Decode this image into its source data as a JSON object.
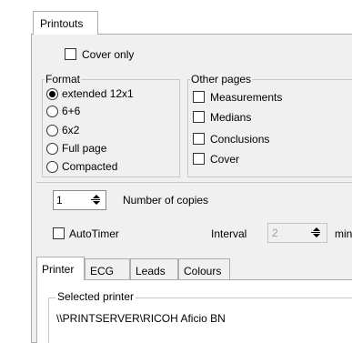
{
  "tabs": {
    "printouts": "Printouts"
  },
  "cover_only": {
    "label": "Cover only",
    "checked": false
  },
  "format": {
    "title": "Format",
    "options": [
      {
        "label": "extended 12x1",
        "selected": true
      },
      {
        "label": "6+6",
        "selected": false
      },
      {
        "label": "6x2",
        "selected": false
      },
      {
        "label": "Full page",
        "selected": false
      },
      {
        "label": "Compacted",
        "selected": false
      }
    ]
  },
  "other_pages": {
    "title": "Other pages",
    "items": [
      {
        "label": "Measurements",
        "checked": false
      },
      {
        "label": "Medians",
        "checked": false
      },
      {
        "label": "Conclusions",
        "checked": false
      },
      {
        "label": "Cover",
        "checked": false
      }
    ]
  },
  "copies": {
    "value": "1",
    "label": "Number of copies"
  },
  "autotimer": {
    "label": "AutoTimer",
    "checked": false
  },
  "interval": {
    "label": "Interval",
    "value": "2",
    "unit": "min"
  },
  "subtabs": {
    "printer": "Printer",
    "ecg": "ECG",
    "leads": "Leads",
    "colours": "Colours"
  },
  "selected_printer": {
    "title": "Selected printer",
    "name": "\\\\PRINTSERVER\\RICOH Aficio BN"
  }
}
